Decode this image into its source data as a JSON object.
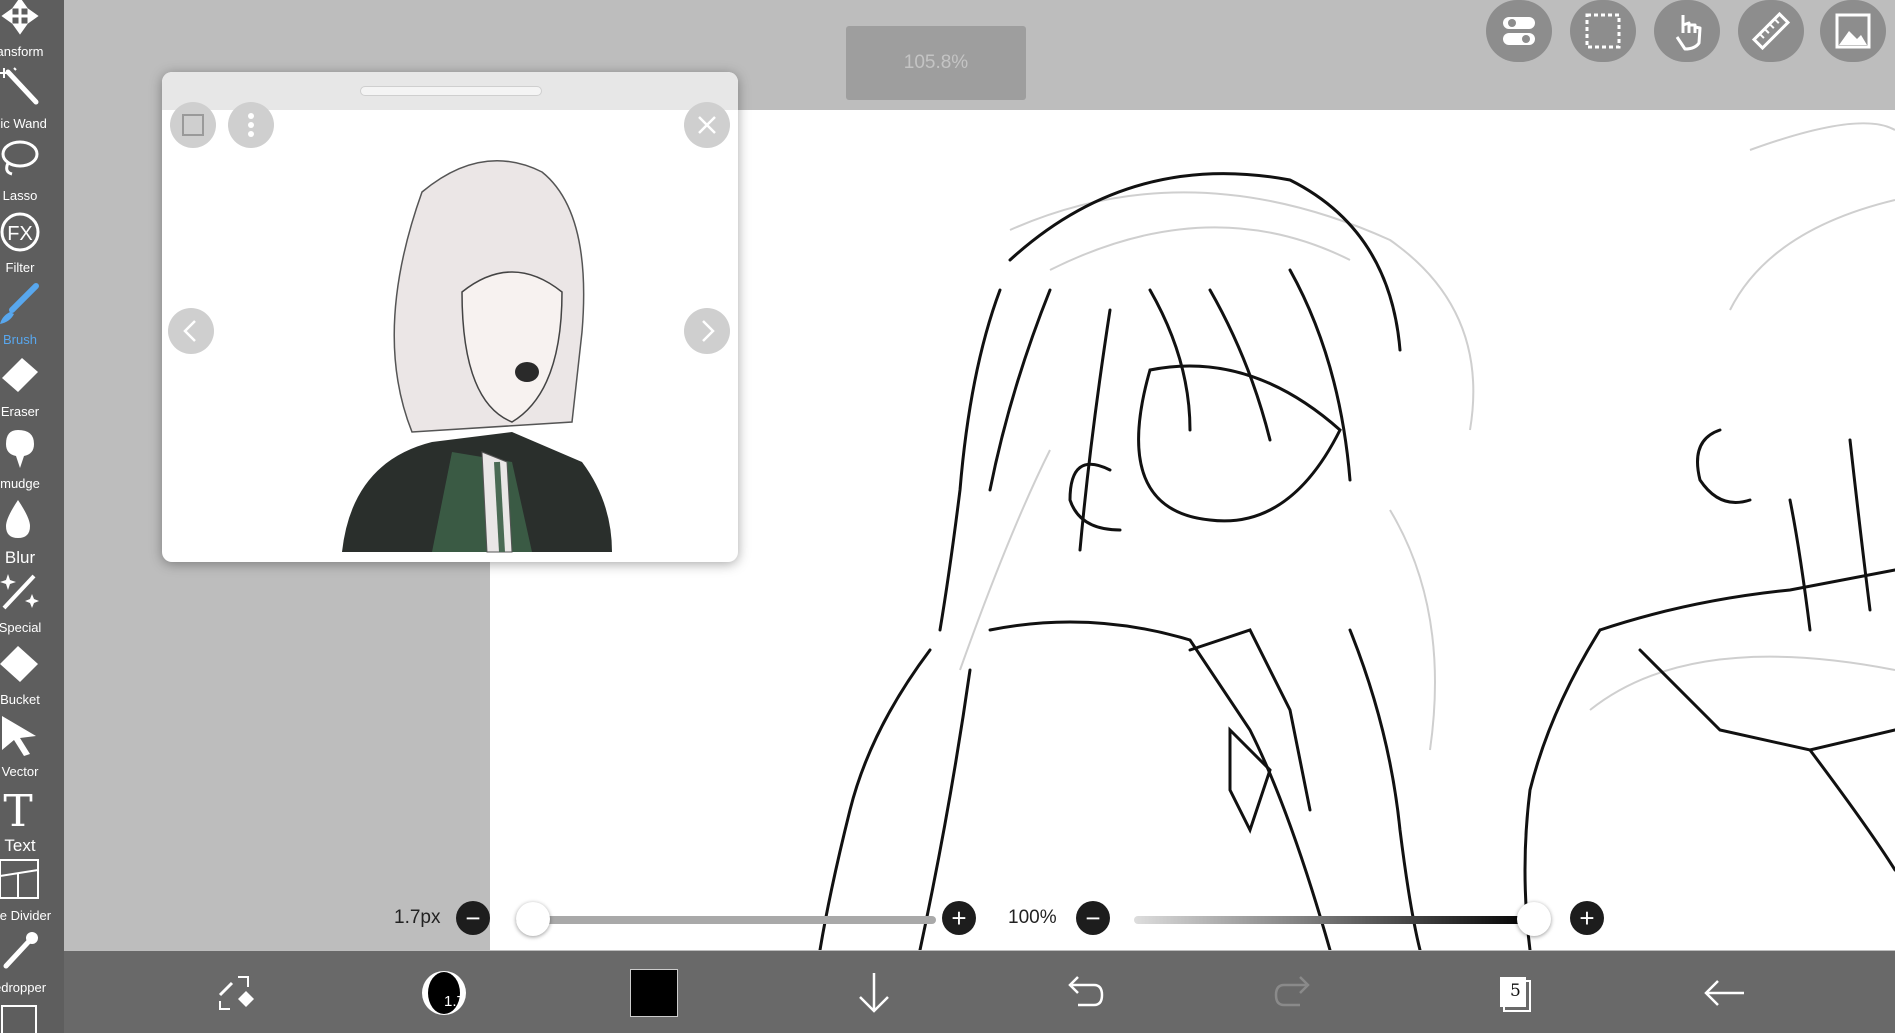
{
  "zoom_label": "105.8%",
  "toolbar": {
    "tools": [
      {
        "key": "transform",
        "label": "ansform",
        "icon": "move-arrows-icon"
      },
      {
        "key": "magic-wand",
        "label": "gic Wand",
        "icon": "magic-wand-icon"
      },
      {
        "key": "lasso",
        "label": "Lasso",
        "icon": "lasso-icon"
      },
      {
        "key": "filter",
        "label": "Filter",
        "icon": "fx-icon"
      },
      {
        "key": "brush",
        "label": "Brush",
        "icon": "brush-icon",
        "active": true
      },
      {
        "key": "eraser",
        "label": "Eraser",
        "icon": "eraser-icon"
      },
      {
        "key": "smudge",
        "label": "mudge",
        "icon": "smudge-icon"
      },
      {
        "key": "blur",
        "label": "Blur",
        "icon": "droplet-icon"
      },
      {
        "key": "special",
        "label": "Special",
        "icon": "sparkle-brush-icon"
      },
      {
        "key": "bucket",
        "label": "Bucket",
        "icon": "bucket-icon"
      },
      {
        "key": "vector",
        "label": "Vector",
        "icon": "cursor-arrow-icon"
      },
      {
        "key": "text",
        "label": "Text",
        "icon": "text-t-icon"
      },
      {
        "key": "frame-divider",
        "label": "me Divider",
        "icon": "frame-divider-icon"
      },
      {
        "key": "eyedropper",
        "label": "edropper",
        "icon": "eyedropper-icon"
      }
    ],
    "accent_color": "#58a7ee"
  },
  "top_buttons": [
    "toggles-icon",
    "selection-icon",
    "touch-hand-icon",
    "ruler-icon",
    "image-icon"
  ],
  "reference_window": {
    "buttons": [
      "square-icon",
      "more-vertical-icon",
      "close-icon",
      "chevron-left-icon",
      "chevron-right-icon"
    ]
  },
  "sliders": {
    "size_label": "1.7px",
    "size_value_fraction": 0.01,
    "opacity_label": "100%",
    "opacity_value_fraction": 1.0
  },
  "bottombar": {
    "brush_size_badge": "1.7",
    "current_color": "#000000",
    "layers_count": "5",
    "icons": [
      "swap-brush-eraser-icon",
      "brush-preview-icon",
      "color-swatch-icon",
      "download-arrow-icon",
      "undo-icon",
      "redo-icon",
      "layers-icon",
      "back-arrow-icon"
    ]
  }
}
